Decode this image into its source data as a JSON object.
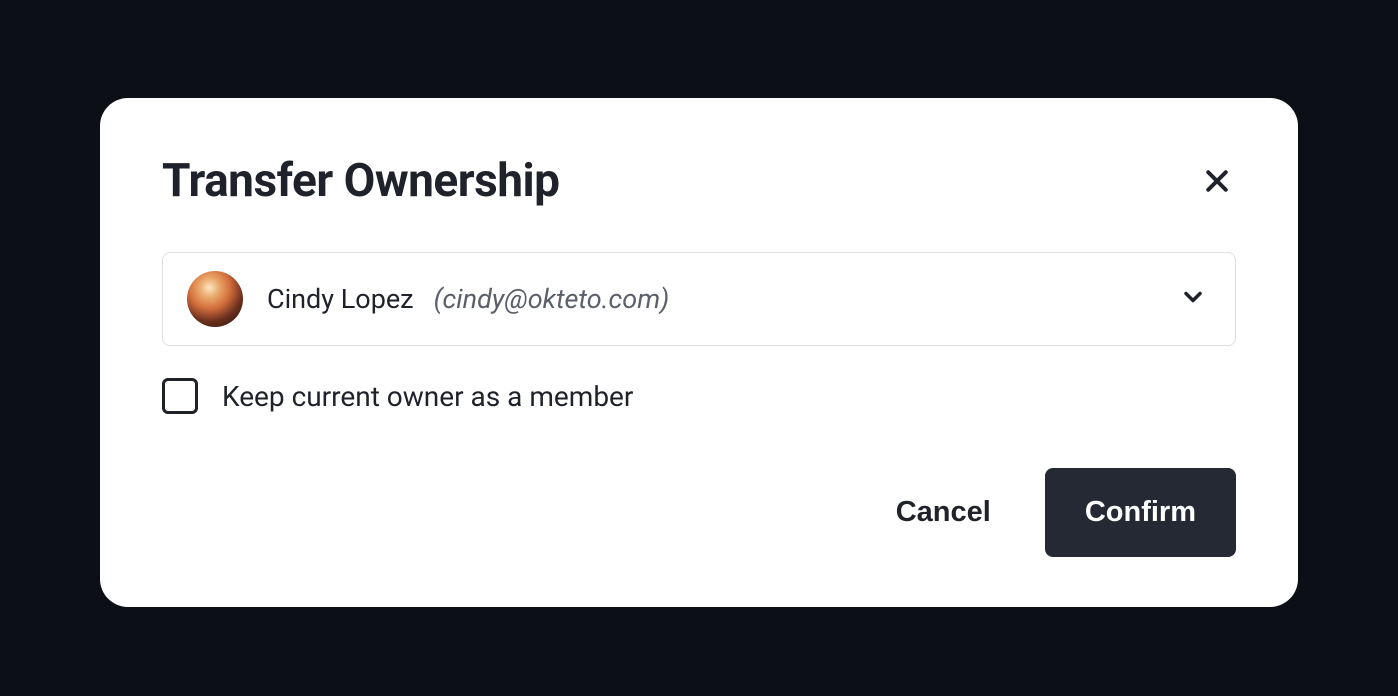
{
  "modal": {
    "title": "Transfer Ownership",
    "selected_user": {
      "name": "Cindy Lopez",
      "email": "(cindy@okteto.com)"
    },
    "checkbox_label": "Keep current owner as a member",
    "cancel_label": "Cancel",
    "confirm_label": "Confirm"
  }
}
